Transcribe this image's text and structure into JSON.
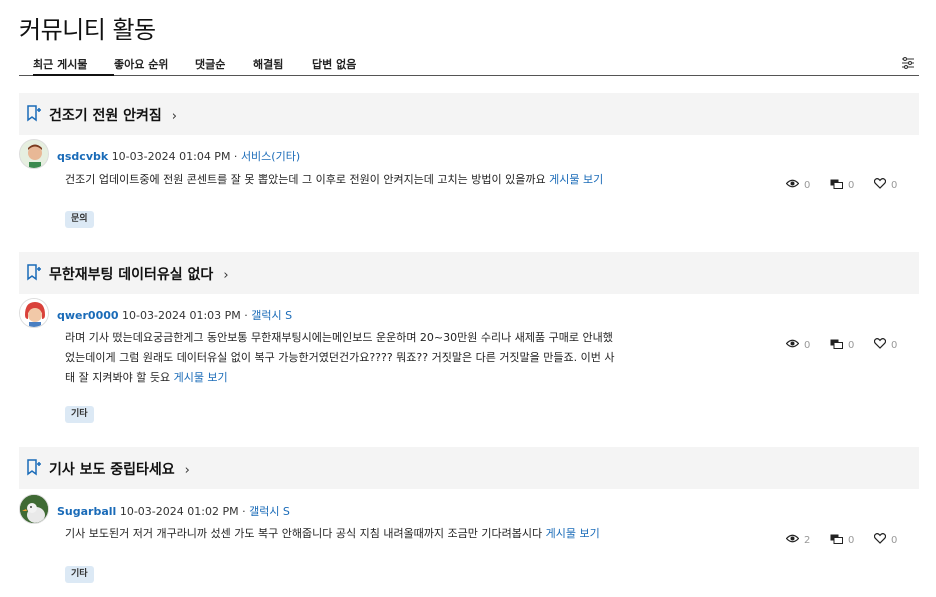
{
  "page": {
    "title": "커뮤니티 활동"
  },
  "tabs": [
    {
      "label": "최근 게시물"
    },
    {
      "label": "좋아요 순위"
    },
    {
      "label": "댓글순"
    },
    {
      "label": "해결됨"
    },
    {
      "label": "답변 없음"
    }
  ],
  "posts": [
    {
      "title": "건조기 전원 안켜짐",
      "author": "qsdcvbk",
      "datetime": "10-03-2024 01:04 PM",
      "category": "서비스(기타)",
      "body": "건조기 업데이트중에 전원 콘센트를 잘 못 뽑았는데 그 이후로 전원이 안켜지는데 고치는 방법이 있을까요",
      "link": "게시물 보기",
      "tag": "문의",
      "views": "0",
      "replies": "0",
      "likes": "0"
    },
    {
      "title": "무한재부팅 데이터유실 없다",
      "author": "qwer0000",
      "datetime": "10-03-2024 01:03 PM",
      "category": "갤럭시 S",
      "body_lines": [
        "라며 기사 떴는데요궁금한게그 동안보통 무한재부팅시에는메인보드 운운하며 20~30만원 수리나 새제품 구매로 안내했",
        "었는데이게 그럼 원래도 데이터유실 없이 복구 가능한거였던건가요???? 뭐죠?? 거짓말은 다른 거짓말을 만들죠. 이번 사",
        "태 잘 지켜봐야 할 듯요"
      ],
      "link": "게시물 보기",
      "tag": "기타",
      "views": "0",
      "replies": "0",
      "likes": "0"
    },
    {
      "title": "기사 보도 중립타세요",
      "author": "Sugarball",
      "datetime": "10-03-2024 01:02 PM",
      "category": "갤럭시 S",
      "body": "기사 보도된거 저거 개구라니까 섰센 가도 복구 안해줍니다 공식 지침 내려올때까지 조금만 기다려봅시다",
      "link": "게시물 보기",
      "tag": "기타",
      "views": "2",
      "replies": "0",
      "likes": "0"
    }
  ],
  "icons": {
    "bookmark": "bookmark-plus-icon",
    "chevron": "chevron-right-icon",
    "views": "eye-icon",
    "replies": "comments-icon",
    "likes": "heart-icon",
    "filter": "filter-settings-icon"
  },
  "colors": {
    "link": "#1a6bb8",
    "tag_bg": "#dce9f5",
    "header_bg": "#f4f4f4"
  }
}
